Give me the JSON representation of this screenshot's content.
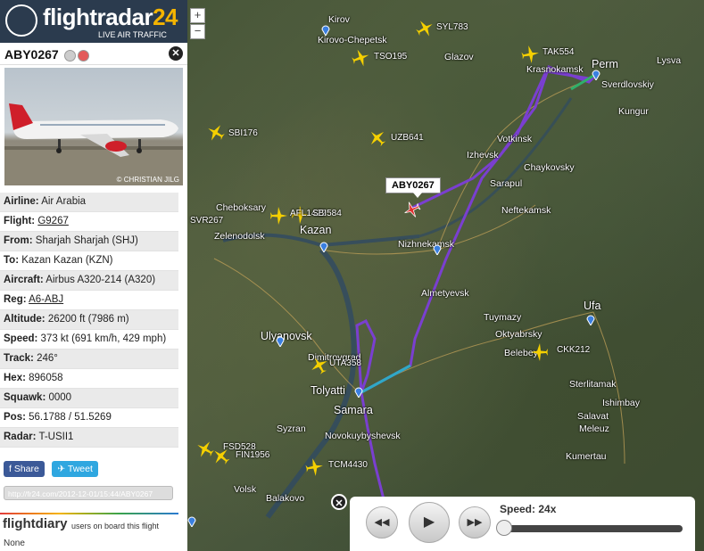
{
  "brand": {
    "name_a": "flightradar",
    "name_b": "24",
    "tagline": "LIVE AIR TRAFFIC"
  },
  "zoom": {
    "plus": "+",
    "minus": "−"
  },
  "flight": {
    "callsign": "ABY0267",
    "photo_credit": "© CHRISTIAN JILG",
    "details": [
      {
        "label": "Airline:",
        "value": "Air Arabia"
      },
      {
        "label": "Flight:",
        "value": "G9267"
      },
      {
        "label": "From:",
        "value": "Sharjah Sharjah (SHJ)"
      },
      {
        "label": "To:",
        "value": "Kazan Kazan (KZN)"
      },
      {
        "label": "Aircraft:",
        "value": "Airbus A320-214 (A320)"
      },
      {
        "label": "Reg:",
        "value": "A6-ABJ"
      },
      {
        "label": "Altitude:",
        "value": "26200 ft (7986 m)"
      },
      {
        "label": "Speed:",
        "value": "373 kt (691 km/h, 429 mph)"
      },
      {
        "label": "Track:",
        "value": "246°"
      },
      {
        "label": "Hex:",
        "value": "896058"
      },
      {
        "label": "Squawk:",
        "value": "0000"
      },
      {
        "label": "Pos:",
        "value": "56.1788 / 51.5269"
      },
      {
        "label": "Radar:",
        "value": "T-USII1"
      }
    ]
  },
  "share": {
    "facebook": "Share",
    "twitter": "Tweet"
  },
  "permalink": "http://fr24.com/2012-12-01/15:44/ABY0267",
  "flightdiary": {
    "logo": "flightdiary",
    "text": "users on board this flight",
    "none": "None"
  },
  "map": {
    "callout": "ABY0267",
    "cities": [
      "Kirov",
      "Kirovo-Chepetsk",
      "Glazov",
      "Krasnokamsk",
      "Perm",
      "Sverdlovskiy",
      "Lysva",
      "Kungur",
      "Votkinsk",
      "Izhevsk",
      "Chaykovsky",
      "Sarapul",
      "Neftekamsk",
      "Cheboksary",
      "Zelenodolsk",
      "Kazan",
      "Nizhnekamsk",
      "Almetyevsk",
      "Tuymazy",
      "Oktyabrsky",
      "Belebey",
      "Ufa",
      "Ulyanovsk",
      "Dimitrovgrad",
      "Tolyatti",
      "Samara",
      "Novokuybyshevsk",
      "Syzran",
      "Sterlitamak",
      "Ishimbay",
      "Salavat",
      "Meleuz",
      "Kumertau",
      "Volsk",
      "Balakovo"
    ],
    "traffic": [
      "SYL783",
      "TSO195",
      "TAK554",
      "SBI176",
      "UZB641",
      "SVR267",
      "AFL1422",
      "SBI584",
      "CKK212",
      "UTA358",
      "FSD528",
      "FIN1956",
      "TCM4430"
    ]
  },
  "playback": {
    "speed": "Speed: 24x"
  }
}
